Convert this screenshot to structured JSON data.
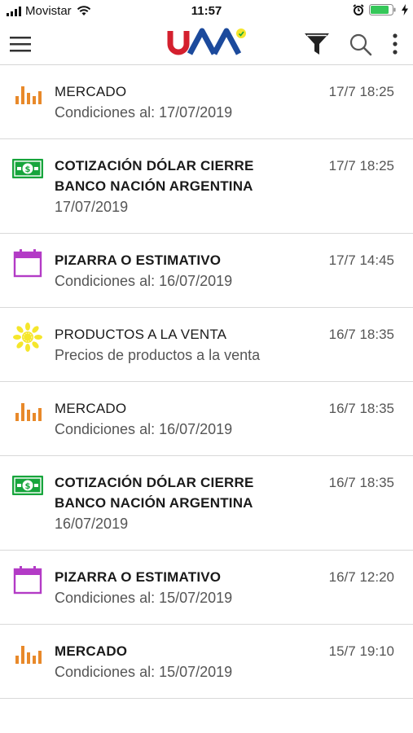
{
  "status_bar": {
    "carrier": "Movistar",
    "time": "11:57"
  },
  "navbar": {
    "logo_text": "UAA",
    "menu_icon": "hamburger-icon",
    "filter_icon": "filter-icon",
    "search_icon": "search-icon",
    "more_icon": "more-vertical-icon"
  },
  "colors": {
    "market": "#e8892a",
    "dollar": "#17a53c",
    "calendar": "#b33bc6",
    "products": "#f5e62b",
    "logo_red": "#d4202e",
    "logo_blue": "#1c4a9c"
  },
  "notifications": [
    {
      "icon": "bar-chart-icon",
      "title": "MERCADO",
      "subtitle": "Condiciones al: 17/07/2019",
      "time": "17/7 18:25"
    },
    {
      "icon": "dollar-bill-icon",
      "title": "COTIZACIÓN DÓLAR CIERRE BANCO NACIÓN ARGENTINA",
      "subtitle": "17/07/2019",
      "time": "17/7 18:25"
    },
    {
      "icon": "calendar-icon",
      "title": "PIZARRA O ESTIMATIVO",
      "subtitle": "Condiciones al: 16/07/2019",
      "time": "17/7 14:45"
    },
    {
      "icon": "sunflower-icon",
      "title": "PRODUCTOS A LA VENTA",
      "subtitle": "Precios de productos a la venta",
      "time": "16/7 18:35"
    },
    {
      "icon": "bar-chart-icon",
      "title": "MERCADO",
      "subtitle": "Condiciones al: 16/07/2019",
      "time": "16/7 18:35"
    },
    {
      "icon": "dollar-bill-icon",
      "title": "COTIZACIÓN DÓLAR CIERRE BANCO NACIÓN ARGENTINA",
      "subtitle": "16/07/2019",
      "time": "16/7 18:35"
    },
    {
      "icon": "calendar-icon",
      "title": "PIZARRA O ESTIMATIVO",
      "subtitle": "Condiciones al: 15/07/2019",
      "time": "16/7 12:20"
    },
    {
      "icon": "bar-chart-icon",
      "title": "MERCADO",
      "subtitle": "Condiciones al: 15/07/2019",
      "time": "15/7 19:10"
    }
  ]
}
